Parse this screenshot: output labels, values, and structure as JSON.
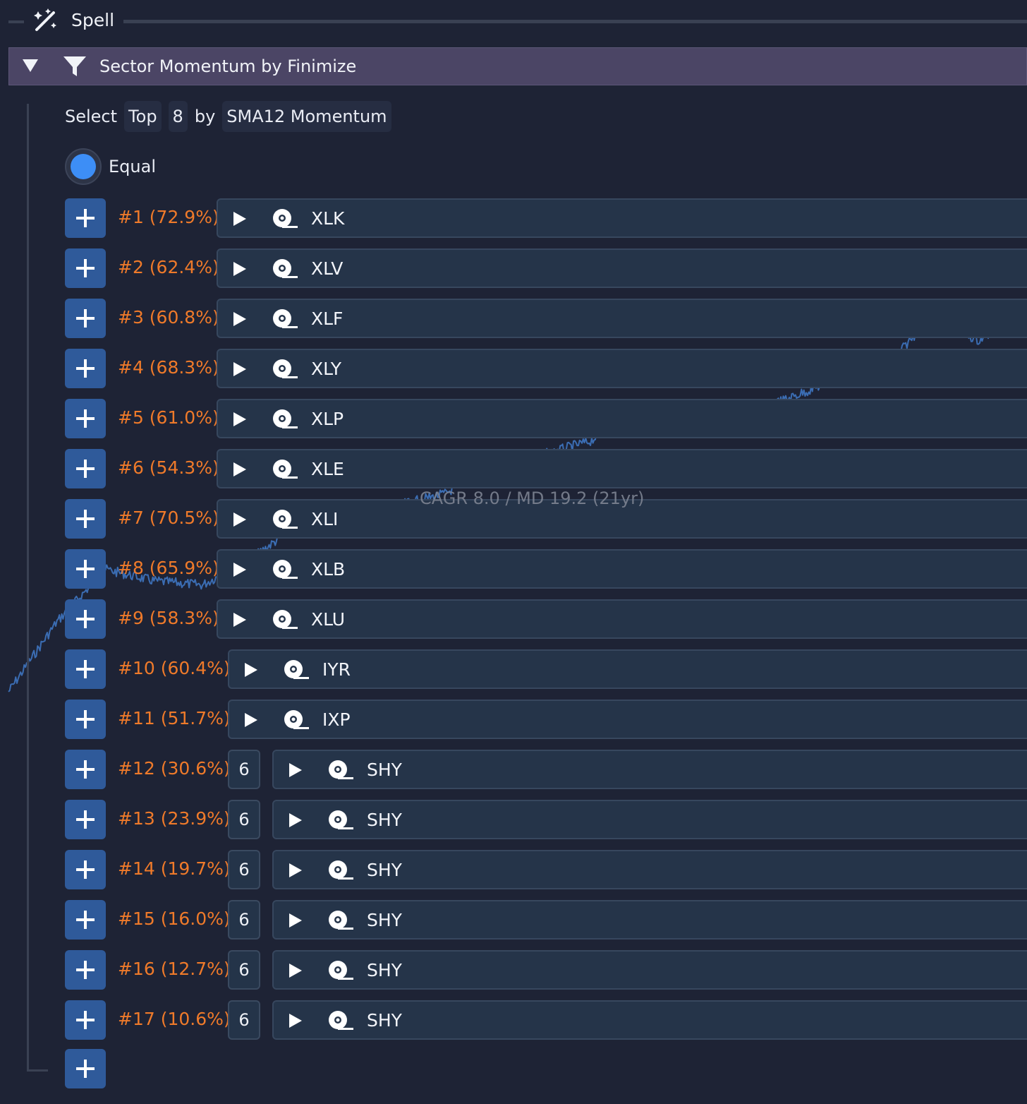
{
  "spell": {
    "title": "Spell"
  },
  "header": {
    "title": "Sector Momentum by Finimize"
  },
  "select": {
    "word": "Select",
    "mode": "Top",
    "count": "8",
    "by": "by",
    "metric": "SMA12 Momentum"
  },
  "weighting": {
    "label": "Equal"
  },
  "rows": [
    {
      "rank": "#1 (72.9%)",
      "ticker": "XLK",
      "count": ""
    },
    {
      "rank": "#2 (62.4%)",
      "ticker": "XLV",
      "count": ""
    },
    {
      "rank": "#3 (60.8%)",
      "ticker": "XLF",
      "count": ""
    },
    {
      "rank": "#4 (68.3%)",
      "ticker": "XLY",
      "count": ""
    },
    {
      "rank": "#5 (61.0%)",
      "ticker": "XLP",
      "count": ""
    },
    {
      "rank": "#6 (54.3%)",
      "ticker": "XLE",
      "count": ""
    },
    {
      "rank": "#7 (70.5%)",
      "ticker": "XLI",
      "count": ""
    },
    {
      "rank": "#8 (65.9%)",
      "ticker": "XLB",
      "count": ""
    },
    {
      "rank": "#9 (58.3%)",
      "ticker": "XLU",
      "count": ""
    },
    {
      "rank": "#10 (60.4%)",
      "ticker": "IYR",
      "count": ""
    },
    {
      "rank": "#11 (51.7%)",
      "ticker": "IXP",
      "count": ""
    },
    {
      "rank": "#12 (30.6%)",
      "ticker": "SHY",
      "count": "6"
    },
    {
      "rank": "#13 (23.9%)",
      "ticker": "SHY",
      "count": "6"
    },
    {
      "rank": "#14 (19.7%)",
      "ticker": "SHY",
      "count": "6"
    },
    {
      "rank": "#15 (16.0%)",
      "ticker": "SHY",
      "count": "6"
    },
    {
      "rank": "#16 (12.7%)",
      "ticker": "SHY",
      "count": "6"
    },
    {
      "rank": "#17 (10.6%)",
      "ticker": "SHY",
      "count": "6"
    }
  ],
  "chart_data": {
    "type": "line",
    "annotation": "CAGR 8.0 / MD 19.2 (21yr)",
    "line_color": "#3b6db3",
    "series": [
      {
        "x": [
          0,
          1,
          2,
          3,
          4,
          5,
          6,
          7,
          8,
          9,
          10,
          11,
          12,
          13,
          14,
          15,
          16,
          17,
          18,
          19,
          20,
          21
        ],
        "values": [
          100,
          155,
          215,
          200,
          195,
          230,
          285,
          300,
          320,
          345,
          415,
          440,
          480,
          595,
          550,
          570,
          620,
          700,
          735,
          1040,
          900,
          1085
        ]
      }
    ]
  }
}
